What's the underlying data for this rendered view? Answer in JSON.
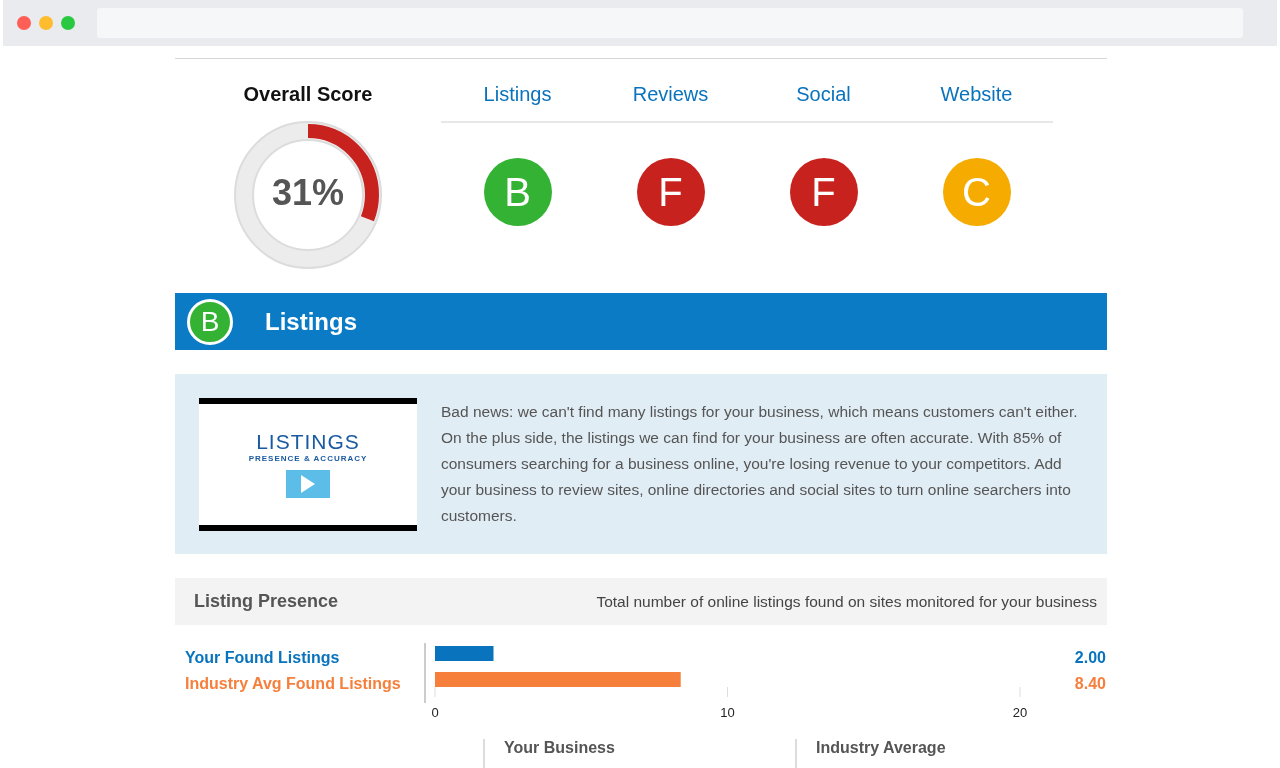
{
  "overall_score": {
    "title": "Overall Score",
    "value": "31%",
    "level": 0.31
  },
  "tabs": [
    {
      "label": "Listings",
      "grade": "B",
      "color": "#34b233"
    },
    {
      "label": "Reviews",
      "grade": "F",
      "color": "#c8221f"
    },
    {
      "label": "Social",
      "grade": "F",
      "color": "#c8221f"
    },
    {
      "label": "Website",
      "grade": "C",
      "color": "#f5ab00"
    }
  ],
  "section": {
    "grade": "B",
    "color": "#34b233",
    "title": "Listings"
  },
  "video": {
    "title": "LISTINGS",
    "subtitle": "PRESENCE & ACCURACY"
  },
  "description": "Bad news: we can't find many listings for your business, which means customers can't either. On the plus side, the listings we can find for your business are often accurate. With 85% of consumers searching for a business online, you're losing revenue to your competitors. Add your business to review sites, online directories and social sites to turn online searchers into customers.",
  "listing_presence": {
    "title": "Listing Presence",
    "subtitle": "Total number of online listings found on sites monitored for your business",
    "chart_data": {
      "type": "bar",
      "orientation": "horizontal",
      "series": [
        {
          "name": "Your Found Listings",
          "color": "#0a73bd",
          "values": [
            2.0
          ]
        },
        {
          "name": "Industry Avg Found Listings",
          "color": "#f57f3b",
          "values": [
            8.4
          ]
        }
      ],
      "value_labels": [
        "2.00",
        "8.40"
      ],
      "xlim": [
        0,
        20
      ],
      "xticks": [
        0,
        10,
        20
      ]
    }
  },
  "comparison": [
    {
      "title": "Your Business"
    },
    {
      "title": "Industry Average"
    }
  ]
}
